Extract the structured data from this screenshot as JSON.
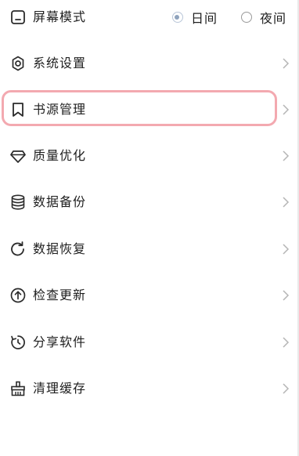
{
  "screen_mode": {
    "label": "屏幕模式",
    "options": [
      {
        "label": "日间",
        "selected": true
      },
      {
        "label": "夜间",
        "selected": false
      }
    ]
  },
  "menu": {
    "items": [
      {
        "label": "系统设置",
        "icon": "gear-icon"
      },
      {
        "label": "书源管理",
        "icon": "bookmark-icon",
        "highlighted": true
      },
      {
        "label": "质量优化",
        "icon": "diamond-icon"
      },
      {
        "label": "数据备份",
        "icon": "database-icon"
      },
      {
        "label": "数据恢复",
        "icon": "refresh-icon"
      },
      {
        "label": "检查更新",
        "icon": "arrow-up-circle-icon"
      },
      {
        "label": "分享软件",
        "icon": "share-rotate-icon"
      },
      {
        "label": "清理缓存",
        "icon": "broom-icon"
      }
    ]
  },
  "colors": {
    "highlight_border": "#f3a9b0",
    "text": "#1f1f1f",
    "icon": "#2b2b2b",
    "chevron": "#b5b5b5",
    "radio_selected": "#8fa3bd"
  }
}
